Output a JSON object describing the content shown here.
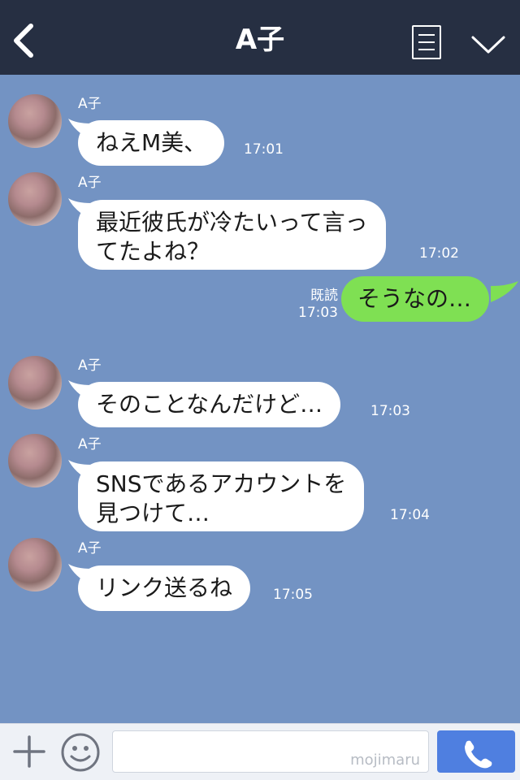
{
  "header": {
    "title": "A子"
  },
  "colors": {
    "header_bg": "#262f42",
    "chat_bg": "#7393c3",
    "incoming_bubble": "#ffffff",
    "outgoing_bubble": "#7fe053",
    "call_button": "#4f7fe0"
  },
  "messages": [
    {
      "sender": "A子",
      "text": "ねえM美、",
      "time": "17:01"
    },
    {
      "sender": "A子",
      "text": "最近彼氏が冷たいって言っ\nてたよね？",
      "time": "17:02"
    },
    {
      "sender": "me",
      "text": "そうなの…",
      "status": "既読",
      "time": "17:03"
    },
    {
      "sender": "A子",
      "text": "そのことなんだけど…",
      "time": "17:03"
    },
    {
      "sender": "A子",
      "text": "SNSであるアカウントを\n見つけて…",
      "time": "17:04"
    },
    {
      "sender": "A子",
      "text": "リンク送るね",
      "time": "17:05"
    }
  ],
  "footer": {
    "watermark": "mojimaru"
  },
  "icons": {
    "back": "chevron-left-icon",
    "menu": "note-menu-icon",
    "collapse": "chevron-down-icon",
    "add": "plus-icon",
    "emoji": "smiley-icon",
    "call": "phone-icon"
  }
}
